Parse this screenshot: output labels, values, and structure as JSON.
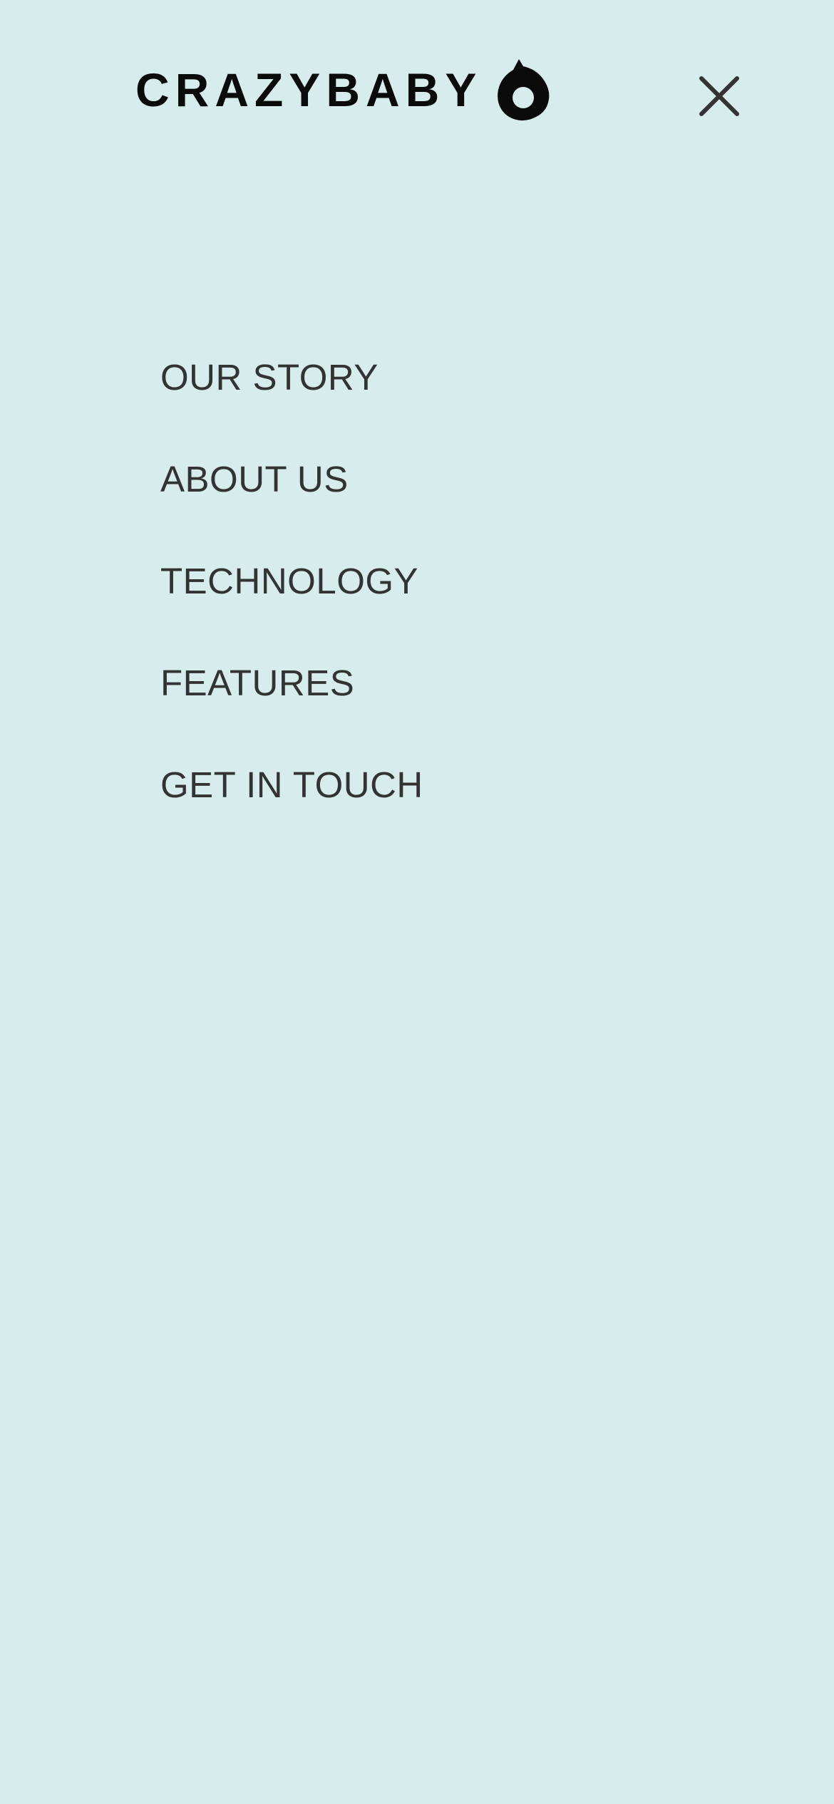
{
  "header": {
    "logo_text": "CRAZYBABY",
    "logo_mark_icon": "crazybaby-drop-logo-icon",
    "close_icon": "close-icon"
  },
  "menu": {
    "items": [
      {
        "label": "OUR STORY"
      },
      {
        "label": "ABOUT US"
      },
      {
        "label": "TECHNOLOGY"
      },
      {
        "label": "FEATURES"
      },
      {
        "label": "GET IN TOUCH"
      }
    ]
  },
  "colors": {
    "background": "#d7ecec",
    "logo": "#0b0b0b",
    "menu_text": "#333333"
  }
}
